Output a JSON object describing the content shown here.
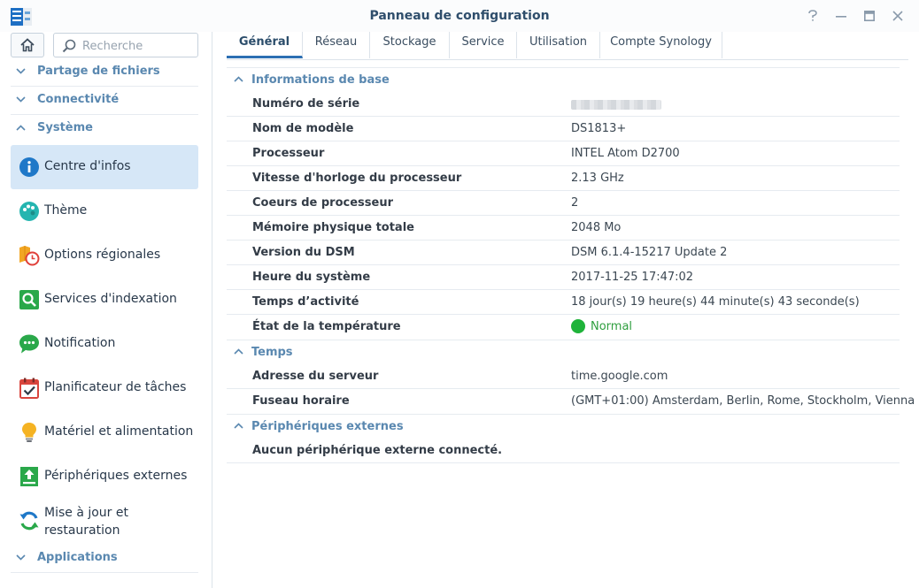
{
  "window": {
    "title": "Panneau de configuration",
    "controls": [
      "help-icon",
      "minimize-icon",
      "maximize-icon",
      "close-icon"
    ]
  },
  "sidebar": {
    "search": {
      "placeholder": "Recherche",
      "value": ""
    },
    "categories": {
      "file_sharing": "Partage de fichiers",
      "connectivity": "Connectivité",
      "system": "Système",
      "applications": "Applications"
    },
    "items": [
      {
        "label": "Centre d'infos",
        "icon": "info-icon",
        "active": true
      },
      {
        "label": "Thème",
        "icon": "palette-icon"
      },
      {
        "label": "Options régionales",
        "icon": "regional-clock-icon"
      },
      {
        "label": "Services d'indexation",
        "icon": "index-search-icon"
      },
      {
        "label": "Notification",
        "icon": "chat-bubble-icon"
      },
      {
        "label": "Planificateur de tâches",
        "icon": "calendar-check-icon"
      },
      {
        "label": "Matériel et alimentation",
        "icon": "lightbulb-icon"
      },
      {
        "label": "Périphériques externes",
        "icon": "upload-device-icon"
      },
      {
        "label_line1": "Mise à jour et",
        "label_line2": "restauration",
        "icon": "refresh-icon"
      }
    ]
  },
  "tabs": [
    "Général",
    "Réseau",
    "Stockage",
    "Service",
    "Utilisation",
    "Compte Synology"
  ],
  "active_tab": "Général",
  "sections": {
    "basic": {
      "title": "Informations de base",
      "rows": [
        {
          "label": "Numéro de série",
          "value": ""
        },
        {
          "label": "Nom de modèle",
          "value": "DS1813+"
        },
        {
          "label": "Processeur",
          "value": "INTEL Atom D2700"
        },
        {
          "label": "Vitesse d'horloge du processeur",
          "value": "2.13 GHz"
        },
        {
          "label": "Coeurs de processeur",
          "value": "2"
        },
        {
          "label": "Mémoire physique totale",
          "value": "2048 Mo"
        },
        {
          "label": "Version du DSM",
          "value": "DSM 6.1.4-15217 Update 2"
        },
        {
          "label": "Heure du système",
          "value": "2017-11-25 17:47:02"
        },
        {
          "label": "Temps d’activité",
          "value": "18 jour(s) 19 heure(s) 44 minute(s) 43 seconde(s)"
        },
        {
          "label": "État de la température",
          "value": "Normal"
        }
      ]
    },
    "time": {
      "title": "Temps",
      "rows": [
        {
          "label": "Adresse du serveur",
          "value": "time.google.com"
        },
        {
          "label": "Fuseau horaire",
          "value": "(GMT+01:00) Amsterdam, Berlin, Rome, Stockholm, Vienna"
        }
      ]
    },
    "external": {
      "title": "Périphériques externes",
      "message": "Aucun périphérique externe connecté."
    }
  },
  "colors": {
    "accent": "#2c6fb3",
    "category_text": "#5a88b0",
    "active_item_bg": "#d6e7f7",
    "status_ok": "#1fb33a"
  }
}
